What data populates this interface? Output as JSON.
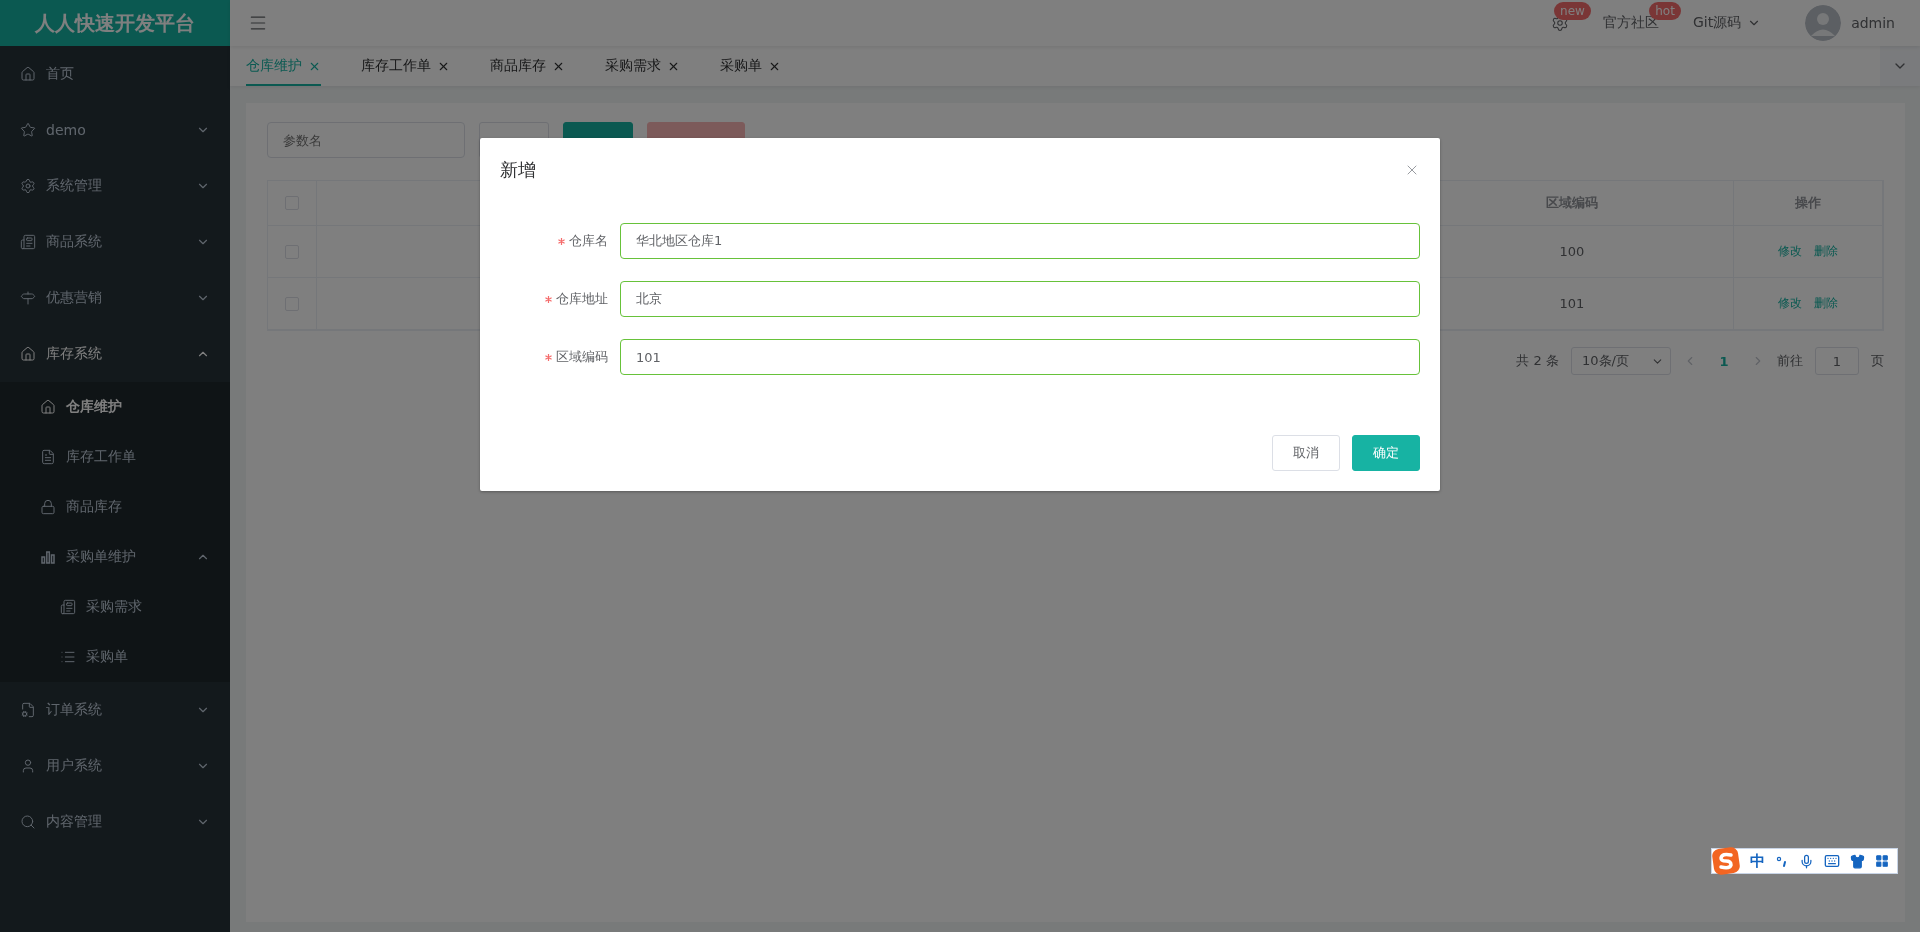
{
  "brand": "人人快速开发平台",
  "header": {
    "menu_items": [
      {
        "kind": "icon",
        "badge": "new"
      },
      {
        "kind": "link",
        "label": "官方社区",
        "badge": "hot"
      },
      {
        "kind": "dropdown",
        "label": "Git源码"
      }
    ],
    "user": {
      "name": "admin"
    }
  },
  "sidebar": {
    "items": [
      {
        "label": "首页",
        "selected": false
      },
      {
        "label": "demo",
        "selected": false,
        "expanded": false
      },
      {
        "label": "系统管理",
        "selected": false,
        "expanded": false
      },
      {
        "label": "商品系统",
        "selected": false,
        "expanded": false
      },
      {
        "label": "优惠营销",
        "selected": false,
        "expanded": false
      },
      {
        "label": "库存系统",
        "selected": false,
        "expanded": true,
        "children": [
          {
            "label": "仓库维护",
            "selected": true
          },
          {
            "label": "库存工作单",
            "selected": false
          },
          {
            "label": "商品库存",
            "selected": false
          },
          {
            "label": "采购单维护",
            "selected": false,
            "expanded": true,
            "children": [
              {
                "label": "采购需求",
                "selected": false
              },
              {
                "label": "采购单",
                "selected": false
              }
            ]
          }
        ]
      },
      {
        "label": "订单系统",
        "selected": false,
        "expanded": false
      },
      {
        "label": "用户系统",
        "selected": false,
        "expanded": false
      },
      {
        "label": "内容管理",
        "selected": false,
        "expanded": false
      }
    ]
  },
  "tabs": [
    {
      "label": "仓库维护",
      "selected": true
    },
    {
      "label": "库存工作单",
      "selected": false
    },
    {
      "label": "商品库存",
      "selected": false
    },
    {
      "label": "采购需求",
      "selected": false
    },
    {
      "label": "采购单",
      "selected": false
    }
  ],
  "toolbar": {
    "search": {
      "placeholder": "参数名"
    },
    "buttons": [
      {
        "kind": "default"
      },
      {
        "kind": "primary"
      },
      {
        "kind": "danger",
        "disabled": true
      }
    ]
  },
  "table": {
    "header_checked": false,
    "columns": [
      "区域编码",
      "操作"
    ],
    "rows": [
      {
        "checked": false,
        "code": "100",
        "actions": [
          "修改",
          "删除"
        ]
      },
      {
        "checked": false,
        "code": "101",
        "actions": [
          "修改",
          "删除"
        ]
      }
    ]
  },
  "pagination": {
    "total": "共 2 条",
    "page_size": "10条/页",
    "pages": [
      {
        "label": "1",
        "selected": true
      }
    ],
    "jump_label": "前往",
    "jump_value": "1",
    "unit": "页"
  },
  "dialog": {
    "title": "新增",
    "fields": [
      {
        "label": "仓库名",
        "required": true,
        "value": "华北地区仓库1"
      },
      {
        "label": "仓库地址",
        "required": true,
        "value": "北京"
      },
      {
        "label": "区域编码",
        "required": true,
        "value": "101"
      }
    ],
    "buttons": [
      {
        "label": "取消",
        "kind": "default"
      },
      {
        "label": "确定",
        "kind": "primary"
      }
    ]
  },
  "ime": {
    "label": "中"
  }
}
